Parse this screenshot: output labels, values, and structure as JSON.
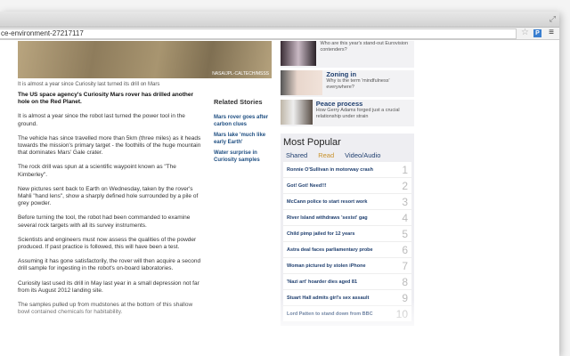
{
  "browser": {
    "url": "ce-environment-27217117"
  },
  "article": {
    "image_credit": "NASA/JPL-CALTECH/MSSS",
    "caption": "It is almost a year since Curiosity last turned its drill on Mars",
    "paragraphs": [
      "The US space agency's Curiosity Mars rover has drilled another hole on the Red Planet.",
      "It is almost a year since the robot last turned the power tool in the ground.",
      "The vehicle has since travelled more than 5km (three miles) as it heads towards the mission's primary target - the foothills of the huge mountain that dominates Mars' Gale crater.",
      "The rock drill was spun at a scientific waypoint known as \"The Kimberley\".",
      "New pictures sent back to Earth on Wednesday, taken by the rover's Mahli \"hand lens\", show a sharply defined hole surrounded by a pile of grey powder.",
      "Before turning the tool, the robot had been commanded to examine several rock targets with all its survey instruments.",
      "Scientists and engineers must now assess the qualities of the powder produced. If past practice is followed, this will have been a test.",
      "Assuming it has gone satisfactorily, the rover will then acquire a second drill sample for ingesting in the robot's on-board laboratories.",
      "Curiosity last used its drill in May last year in a small depression not far from its August 2012 landing site.",
      "The samples pulled up from mudstones at the bottom of this shallow bowl contained chemicals for habitability."
    ]
  },
  "related": {
    "title": "Related Stories",
    "links": [
      "Mars rover goes after carbon clues",
      "Mars lake 'much like early Earth'",
      "Water surprise in Curiosity samples"
    ]
  },
  "promos": [
    {
      "title": "",
      "desc": "Who are this year's stand-out Eurovision contenders?"
    },
    {
      "title": "Zoning in",
      "desc": "Why is the term 'mindfulness' everywhere?"
    },
    {
      "title": "Peace process",
      "desc": "How Gerry Adams forged just a crucial relationship under strain"
    }
  ],
  "most_popular": {
    "title": "Most Popular",
    "tabs": [
      "Shared",
      "Read",
      "Video/Audio"
    ],
    "active_tab": "Read",
    "items": [
      {
        "n": "1",
        "h": "Ronnie O'Sullivan in motorway crash"
      },
      {
        "n": "2",
        "h": "Got! Got! Need!!!"
      },
      {
        "n": "3",
        "h": "McCann police to start resort work"
      },
      {
        "n": "4",
        "h": "River Island withdraws 'sexist' gag"
      },
      {
        "n": "5",
        "h": "Child pimp jailed for 12 years"
      },
      {
        "n": "6",
        "h": "Astra deal faces parliamentary probe"
      },
      {
        "n": "7",
        "h": "Woman pictured by stolen iPhone"
      },
      {
        "n": "8",
        "h": "'Nazi art' hoarder dies aged 81"
      },
      {
        "n": "9",
        "h": "Stuart Hall admits girl's sex assault"
      },
      {
        "n": "10",
        "h": "Lord Patten to stand down from BBC"
      }
    ]
  }
}
